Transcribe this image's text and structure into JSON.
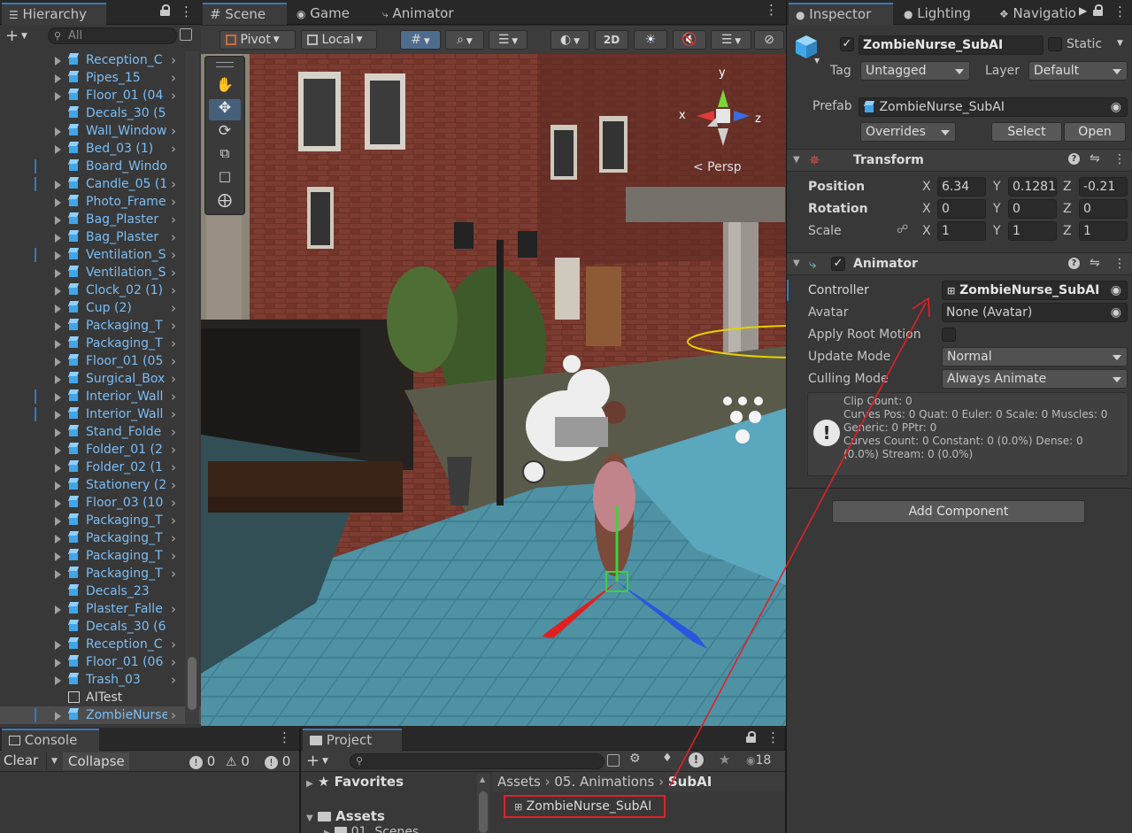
{
  "hierarchy": {
    "tab": "Hierarchy",
    "search_placeholder": "All",
    "items": [
      {
        "label": "Reception_C",
        "arrow": true,
        "mark": false
      },
      {
        "label": "Pipes_15",
        "arrow": true,
        "mark": false
      },
      {
        "label": "Floor_01 (04",
        "arrow": true,
        "mark": false
      },
      {
        "label": "Decals_30 (5",
        "arrow": false,
        "mark": false
      },
      {
        "label": "Wall_Window",
        "arrow": true,
        "mark": false
      },
      {
        "label": "Bed_03 (1)",
        "arrow": true,
        "mark": false
      },
      {
        "label": "Board_Windo",
        "arrow": false,
        "mark": true
      },
      {
        "label": "Candle_05 (1",
        "arrow": true,
        "mark": true
      },
      {
        "label": "Photo_Frame",
        "arrow": true,
        "mark": false
      },
      {
        "label": "Bag_Plaster",
        "arrow": true,
        "mark": false
      },
      {
        "label": "Bag_Plaster",
        "arrow": true,
        "mark": false
      },
      {
        "label": "Ventilation_S",
        "arrow": true,
        "mark": true
      },
      {
        "label": "Ventilation_S",
        "arrow": true,
        "mark": false
      },
      {
        "label": "Clock_02 (1)",
        "arrow": true,
        "mark": false
      },
      {
        "label": "Cup (2)",
        "arrow": true,
        "mark": false
      },
      {
        "label": "Packaging_T",
        "arrow": true,
        "mark": false
      },
      {
        "label": "Packaging_T",
        "arrow": true,
        "mark": false
      },
      {
        "label": "Floor_01 (05",
        "arrow": true,
        "mark": false
      },
      {
        "label": "Surgical_Box",
        "arrow": true,
        "mark": false
      },
      {
        "label": "Interior_Wall",
        "arrow": true,
        "mark": true
      },
      {
        "label": "Interior_Wall",
        "arrow": true,
        "mark": true
      },
      {
        "label": "Stand_Folde",
        "arrow": true,
        "mark": false
      },
      {
        "label": "Folder_01 (2",
        "arrow": true,
        "mark": false
      },
      {
        "label": "Folder_02 (1",
        "arrow": true,
        "mark": false
      },
      {
        "label": "Stationery (2",
        "arrow": true,
        "mark": false
      },
      {
        "label": "Floor_03 (10",
        "arrow": true,
        "mark": false
      },
      {
        "label": "Packaging_T",
        "arrow": true,
        "mark": false
      },
      {
        "label": "Packaging_T",
        "arrow": true,
        "mark": false
      },
      {
        "label": "Packaging_T",
        "arrow": true,
        "mark": false
      },
      {
        "label": "Packaging_T",
        "arrow": true,
        "mark": false
      },
      {
        "label": "Decals_23",
        "arrow": false,
        "mark": false
      },
      {
        "label": "Plaster_Falle",
        "arrow": true,
        "mark": false
      },
      {
        "label": "Decals_30 (6",
        "arrow": false,
        "mark": false
      },
      {
        "label": "Reception_C",
        "arrow": true,
        "mark": false
      },
      {
        "label": "Floor_01 (06",
        "arrow": true,
        "mark": false
      },
      {
        "label": "Trash_03",
        "arrow": true,
        "mark": false
      },
      {
        "label": "AITest",
        "arrow": false,
        "mark": false
      },
      {
        "label": "ZombieNurse",
        "arrow": true,
        "mark": true
      }
    ]
  },
  "scene_tabs": [
    "Scene",
    "Game",
    "Animator"
  ],
  "scene_toolbar": {
    "pivot": "Pivot",
    "local": "Local",
    "mode_2d": "2D"
  },
  "scene_view": {
    "persp_label": "< Persp",
    "gizmo_x": "x",
    "gizmo_y": "y",
    "gizmo_z": "z"
  },
  "inspector": {
    "tabs": [
      "Inspector",
      "Lighting",
      "Navigatio"
    ],
    "object_name": "ZombieNurse_SubAI",
    "static_label": "Static",
    "tag_label": "Tag",
    "tag_value": "Untagged",
    "layer_label": "Layer",
    "layer_value": "Default",
    "prefab_label": "Prefab",
    "prefab_value": "ZombieNurse_SubAI",
    "overrides_label": "Overrides",
    "select_label": "Select",
    "open_label": "Open",
    "transform": {
      "title": "Transform",
      "position_label": "Position",
      "rotation_label": "Rotation",
      "scale_label": "Scale",
      "position": {
        "x": "6.34",
        "y": "0.1281",
        "z": "-0.21"
      },
      "rotation": {
        "x": "0",
        "y": "0",
        "z": "0"
      },
      "scale": {
        "x": "1",
        "y": "1",
        "z": "1"
      },
      "axis_x": "X",
      "axis_y": "Y",
      "axis_z": "Z"
    },
    "animator": {
      "title": "Animator",
      "controller_label": "Controller",
      "controller_value": "ZombieNurse_SubAI",
      "avatar_label": "Avatar",
      "avatar_value": "None (Avatar)",
      "apply_root_motion_label": "Apply Root Motion",
      "update_mode_label": "Update Mode",
      "update_mode_value": "Normal",
      "culling_mode_label": "Culling Mode",
      "culling_mode_value": "Always Animate",
      "info_lines": [
        "Clip Count: 0",
        "Curves Pos: 0 Quat: 0 Euler: 0 Scale: 0 Muscles: 0",
        "Generic: 0 PPtr: 0",
        "Curves Count: 0 Constant: 0 (0.0%) Dense: 0",
        "(0.0%) Stream: 0 (0.0%)"
      ]
    },
    "add_component_label": "Add Component"
  },
  "console": {
    "tab": "Console",
    "clear": "Clear",
    "collapse": "Collapse",
    "log_count": "0",
    "warn_count": "0",
    "error_count": "0"
  },
  "project": {
    "tab": "Project",
    "hidden_count": "18",
    "favorites": "Favorites",
    "assets": "Assets",
    "scenes_folder": "01. Scenes",
    "breadcrumb": [
      "Assets",
      "05. Animations",
      "SubAI"
    ],
    "selected_asset": "ZombieNurse_SubAI"
  },
  "colors": {
    "highlight_red": "#e0202a",
    "selection_blue": "#3a79bb",
    "hierarchy_text": "#7cbef5"
  }
}
